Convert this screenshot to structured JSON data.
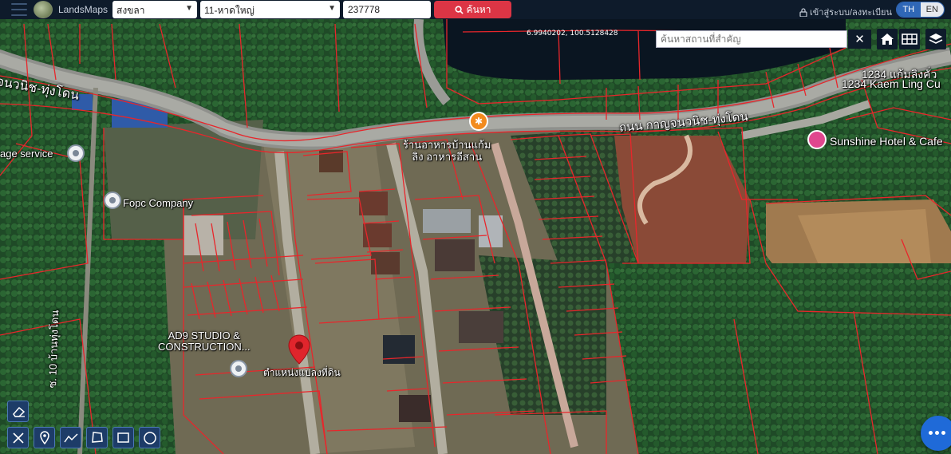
{
  "app": {
    "name": "LandsMaps"
  },
  "filters": {
    "province": "สงขลา",
    "district": "11-หาดใหญ่",
    "parcel_number": "237778",
    "search_label": "ค้นหา"
  },
  "header": {
    "login_label": "เข้าสู่ระบบ/ลงทะเบียน",
    "lang_th": "TH",
    "lang_en": "EN"
  },
  "map": {
    "coordinate": "6.9940202, 100.5128428",
    "place_search_placeholder": "ค้นหาสถานที่สำคัญ",
    "labels": {
      "road_left": "จนวนิช-ทุ่งโดน",
      "road_main": "ถนน กาญจนวนิช-ทุ่งโดน",
      "road_vertical": "ซ. 10 บ้านทุ่งโดน",
      "restaurant": "ร้านอาหารบ้านแก้ม\nลิง อาหารอีสาน",
      "sunshine": "Sunshine Hotel & Cafe",
      "kaem1": "1234 แก้มลิงคั่ว",
      "kaem2": "1234 Kaem Ling Cu",
      "storage": "age service",
      "fopc": "Fopc Company",
      "ad9": "AD9 STUDIO &\nCONSTRUCTION...",
      "parcel_marker": "ตำแหน่งแปลงที่ดิน"
    },
    "icons": [
      "menu-icon",
      "search-icon",
      "lock-icon",
      "home-icon",
      "grid-icon",
      "layers-icon",
      "eraser-icon",
      "tools-icon",
      "pin-icon",
      "polyline-icon",
      "polygon-icon",
      "rectangle-icon",
      "circle-icon",
      "chat-icon"
    ]
  },
  "colors": {
    "parcel_line": "#e8262b",
    "search_btn": "#dc3545",
    "topbar": "#0e1b2b",
    "toolbar": "#1d3c68",
    "fab": "#1f6ad8"
  }
}
